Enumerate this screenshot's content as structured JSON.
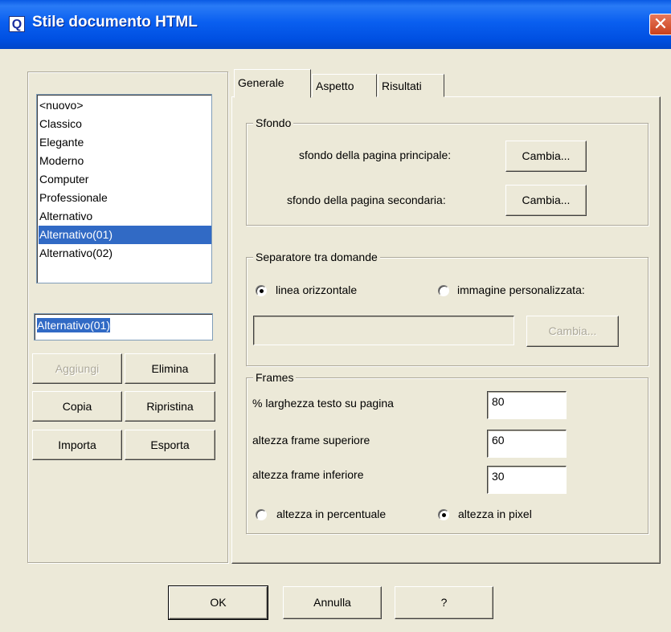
{
  "window": {
    "title": "Stile documento HTML",
    "app_icon_glyph": "Q",
    "close_glyph": "✕"
  },
  "styles_list": {
    "items": [
      "<nuovo>",
      "Classico",
      "Elegante",
      "Moderno",
      "Computer",
      "Professionale",
      "Alternativo",
      "Alternativo(01)",
      "Alternativo(02)"
    ],
    "selected": "Alternativo(01)"
  },
  "name_field": {
    "value": "Alternativo(01)"
  },
  "left_buttons": {
    "add": "Aggiungi",
    "delete": "Elimina",
    "copy": "Copia",
    "restore": "Ripristina",
    "import": "Importa",
    "export": "Esporta"
  },
  "tabs": {
    "general": "Generale",
    "appearance": "Aspetto",
    "results": "Risultati",
    "active": "Generale"
  },
  "background_group": {
    "legend": "Sfondo",
    "main_label": "sfondo della pagina principale:",
    "secondary_label": "sfondo della pagina secondaria:",
    "change": "Cambia..."
  },
  "separator_group": {
    "legend": "Separatore tra domande",
    "horizontal_line": "linea orizzontale",
    "custom_image": "immagine personalizzata:",
    "selected": "linea orizzontale",
    "image_path": "",
    "change": "Cambia..."
  },
  "frames_group": {
    "legend": "Frames",
    "text_width_label": "% larghezza testo su pagina",
    "text_width_value": "80",
    "top_frame_label": "altezza frame superiore",
    "top_frame_value": "60",
    "bottom_frame_label": "altezza frame inferiore",
    "bottom_frame_value": "30",
    "height_percent": "altezza in percentuale",
    "height_pixel": "altezza in pixel",
    "selected": "altezza in pixel"
  },
  "dialog_buttons": {
    "ok": "OK",
    "cancel": "Annulla",
    "help": "?"
  },
  "colors": {
    "titlebar": "#0a5ae4",
    "selection": "#316ac5",
    "dialog_bg": "#ece9d8",
    "close_button": "#d8512c"
  }
}
